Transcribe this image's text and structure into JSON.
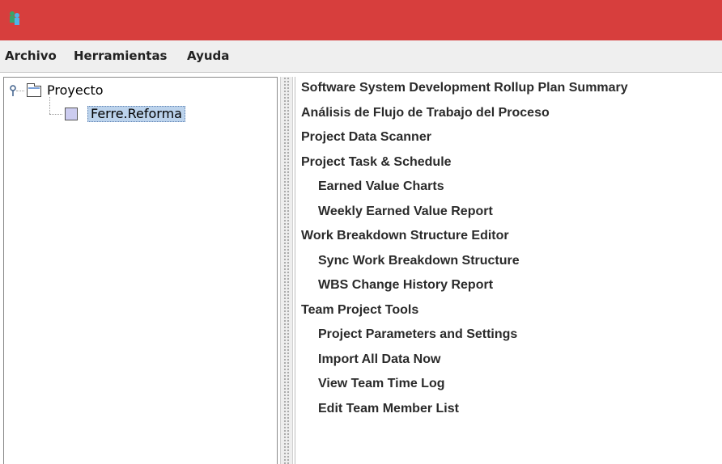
{
  "titlebar": {
    "icon": "team-members-icon",
    "color": "#d73e3d"
  },
  "menu": {
    "items": [
      "Archivo",
      "Herramientas",
      "Ayuda"
    ]
  },
  "tree": {
    "root": {
      "label": "Proyecto",
      "icon": "folder-icon",
      "expanded": true
    },
    "children": [
      {
        "label": "Ferre.Reforma",
        "icon": "project-icon",
        "selected": true
      }
    ],
    "selection_color": "#bcd3ec"
  },
  "scripts": {
    "items": [
      {
        "label": "Software System Development Rollup Plan Summary",
        "level": 0
      },
      {
        "label": "Análisis de Flujo de Trabajo del Proceso",
        "level": 0
      },
      {
        "label": "Project Data Scanner",
        "level": 0
      },
      {
        "label": "Project Task & Schedule",
        "level": 0
      },
      {
        "label": "Earned Value Charts",
        "level": 1
      },
      {
        "label": "Weekly Earned Value Report",
        "level": 1
      },
      {
        "label": "Work Breakdown Structure Editor",
        "level": 0
      },
      {
        "label": "Sync Work Breakdown Structure",
        "level": 1
      },
      {
        "label": "WBS Change History Report",
        "level": 1
      },
      {
        "label": "Team Project Tools",
        "level": 0
      },
      {
        "label": "Project Parameters and Settings",
        "level": 1
      },
      {
        "label": "Import All Data Now",
        "level": 1
      },
      {
        "label": "View Team Time Log",
        "level": 1
      },
      {
        "label": "Edit Team Member List",
        "level": 1
      }
    ]
  }
}
